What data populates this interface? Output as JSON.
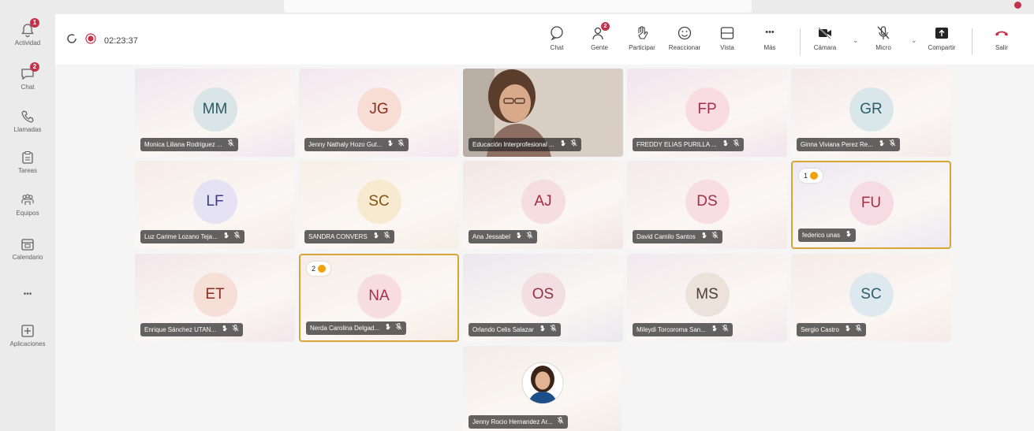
{
  "rail": {
    "items": [
      {
        "label": "Actividad",
        "badge": "1"
      },
      {
        "label": "Chat",
        "badge": "2"
      },
      {
        "label": "Llamadas",
        "badge": ""
      },
      {
        "label": "Tareas",
        "badge": ""
      },
      {
        "label": "Equipos",
        "badge": ""
      },
      {
        "label": "Calendario",
        "badge": ""
      },
      {
        "label": "•••",
        "badge": ""
      },
      {
        "label": "Aplicaciones",
        "badge": ""
      }
    ]
  },
  "toolbar": {
    "timer": "02:23:37",
    "chat": "Chat",
    "people": "Gente",
    "people_badge": "2",
    "participate": "Participar",
    "react": "Reaccionar",
    "view": "Vista",
    "more": "Más",
    "more_glyph": "•••",
    "camera": "Cámara",
    "mic": "Micro",
    "share": "Compartir",
    "leave": "Salir"
  },
  "tiles": [
    {
      "initials": "MM",
      "name": "Monica Liliana Rodriguez ...",
      "bg": "#efe6ee",
      "avatar_bg": "#d9e5e7",
      "avatar_fg": "#2d5a63"
    },
    {
      "initials": "JG",
      "name": "Jenny Nathaly Hozo Gut...",
      "bg": "#f3e7ee",
      "avatar_bg": "#f8ddd5",
      "avatar_fg": "#8a2d1c"
    },
    {
      "initials": "",
      "name": "Educación Interprofesional ...",
      "bg": "#ded6cf",
      "avatar_bg": "",
      "avatar_fg": ""
    },
    {
      "initials": "FP",
      "name": "FREDDY ELIAS PURILLA ...",
      "bg": "#f2e4ec",
      "avatar_bg": "#f8dce2",
      "avatar_fg": "#a33047"
    },
    {
      "initials": "GR",
      "name": "Ginna Viviana Perez Re...",
      "bg": "#f4e9ea",
      "avatar_bg": "#d9e6ea",
      "avatar_fg": "#2c5e6b"
    },
    {
      "initials": "LF",
      "name": "Luz Carime Lozano Teja...",
      "bg": "#f6ece6",
      "avatar_bg": "#e4e2f3",
      "avatar_fg": "#3f3a86"
    },
    {
      "initials": "SC",
      "name": "SANDRA CONVERS",
      "bg": "#f7efe5",
      "avatar_bg": "#f8ead0",
      "avatar_fg": "#7d5414"
    },
    {
      "initials": "AJ",
      "name": "Ana Jessabel",
      "bg": "#f3e6e4",
      "avatar_bg": "#f5dde0",
      "avatar_fg": "#a02c40"
    },
    {
      "initials": "DS",
      "name": "David Camilo Santos",
      "bg": "#f4eaea",
      "avatar_bg": "#f8dde3",
      "avatar_fg": "#a33047"
    },
    {
      "initials": "FU",
      "name": "federico unas",
      "bg": "#ece8f1",
      "avatar_bg": "#f7dbe4",
      "avatar_fg": "#a33047",
      "raised": "1"
    },
    {
      "initials": "ET",
      "name": "Enrique Sánchez UTAN...",
      "bg": "#f2e6ea",
      "avatar_bg": "#f6dfd7",
      "avatar_fg": "#8a2d1c"
    },
    {
      "initials": "NA",
      "name": "Nerda Carolina Delgad...",
      "bg": "#f6ede5",
      "avatar_bg": "#f7dde0",
      "avatar_fg": "#a33047",
      "raised": "2"
    },
    {
      "initials": "OS",
      "name": "Orlando Celis Salazar",
      "bg": "#ebe8ee",
      "avatar_bg": "#f3dfe3",
      "avatar_fg": "#8f3344"
    },
    {
      "initials": "MS",
      "name": "Mileydi Torcoroma San...",
      "bg": "#f1e9ee",
      "avatar_bg": "#ebe2dc",
      "avatar_fg": "#4f3e34"
    },
    {
      "initials": "SC",
      "name": "Sergio Castro",
      "bg": "#f5ebe6",
      "avatar_bg": "#dde9ee",
      "avatar_fg": "#2c5e6b"
    },
    {
      "initials": "",
      "name": "Jenny Rocio Hernandez Ar...",
      "bg": "#f3ece6",
      "avatar_bg": "",
      "avatar_fg": ""
    }
  ]
}
